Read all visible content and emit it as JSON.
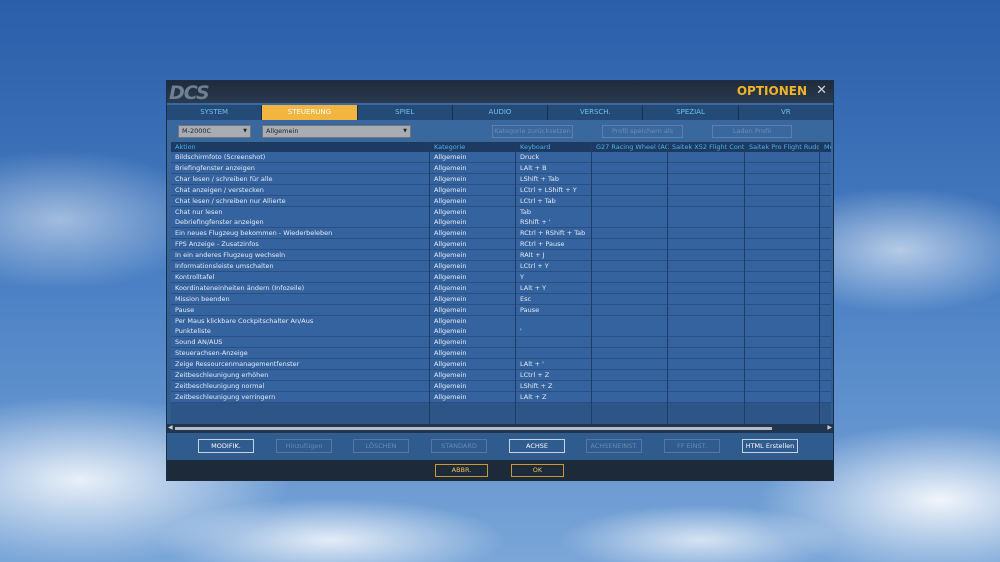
{
  "window": {
    "logo": "DCS",
    "title": "OPTIONEN",
    "close_icon": "close-icon"
  },
  "tabs": [
    {
      "label": "SYSTEM"
    },
    {
      "label": "STEUERUNG",
      "active": true
    },
    {
      "label": "SPIEL"
    },
    {
      "label": "AUDIO"
    },
    {
      "label": "VERSCH."
    },
    {
      "label": "SPEZIAL"
    },
    {
      "label": "VR"
    }
  ],
  "toolbar": {
    "aircraft": "M-2000C",
    "category": "Allgemein",
    "reset_category": "Kategorie zurücksetzen",
    "save_profile": "Profil speichern als",
    "load_profile": "Laden Profil"
  },
  "columns": [
    "Aktion",
    "Kategorie",
    "Keyboard",
    "G27 Racing Wheel (AC",
    "Saitek X52 Flight Cont",
    "Saitek Pro Flight Rudd",
    "Mo"
  ],
  "rows": [
    [
      "Bildschirmfoto (Screenshot)",
      "Allgemein",
      "Druck"
    ],
    [
      "Briefingfenster anzeigen",
      "Allgemein",
      "LAlt + B"
    ],
    [
      "Char lesen / schreiben für alle",
      "Allgemein",
      "LShift + Tab"
    ],
    [
      "Chat anzeigen / verstecken",
      "Allgemein",
      "LCtrl + LShift + Y"
    ],
    [
      "Chat lesen / schreiben nur Allierte",
      "Allgemein",
      "LCtrl + Tab"
    ],
    [
      "Chat nur lesen",
      "Allgemein",
      "Tab"
    ],
    [
      "Debriefingfenster anzeigen",
      "Allgemein",
      "RShift + '"
    ],
    [
      "Ein neues Flugzeug bekommen - Wiederbeleben",
      "Allgemein",
      "RCtrl + RShift + Tab"
    ],
    [
      "FPS Anzeige - Zusatzinfos",
      "Allgemein",
      "RCtrl + Pause"
    ],
    [
      "In ein anderes Flugzeug wechseln",
      "Allgemein",
      "RAlt + J"
    ],
    [
      "Informationsleiste umschalten",
      "Allgemein",
      "LCtrl + Y"
    ],
    [
      "Kontrolltafel",
      "Allgemein",
      "Y"
    ],
    [
      "Koordinateneinheiten ändern (Infozeile)",
      "Allgemein",
      "LAlt + Y"
    ],
    [
      "Mission beenden",
      "Allgemein",
      "Esc"
    ],
    [
      "Pause",
      "Allgemein",
      "Pause"
    ],
    [
      "Per Maus klickbare Cockpitschalter An/Aus",
      "Allgemein",
      ""
    ],
    [
      "Punkteliste",
      "Allgemein",
      "'"
    ],
    [
      "Sound AN/AUS",
      "Allgemein",
      ""
    ],
    [
      "Steuerachsen-Anzeige",
      "Allgemein",
      ""
    ],
    [
      "Zeige Ressourcenmanagementfenster",
      "Allgemein",
      "LAlt + '"
    ],
    [
      "Zeitbeschleunigung erhöhen",
      "Allgemein",
      "LCtrl + Z"
    ],
    [
      "Zeitbeschleunigung normal",
      "Allgemein",
      "LShift + Z"
    ],
    [
      "Zeitbeschleunigung verringern",
      "Allgemein",
      "LAlt + Z"
    ]
  ],
  "actions": [
    {
      "label": "MODIFIK.",
      "enabled": true
    },
    {
      "label": "Hinzufügen",
      "enabled": false
    },
    {
      "label": "LÖSCHEN",
      "enabled": false
    },
    {
      "label": "STANDARD",
      "enabled": false
    },
    {
      "label": "ACHSE",
      "enabled": true
    },
    {
      "label": "ACHSENEINST.",
      "enabled": false
    },
    {
      "label": "FF EINST.",
      "enabled": false
    },
    {
      "label": "HTML Erstellen",
      "enabled": true
    }
  ],
  "footer": {
    "cancel": "ABBR.",
    "ok": "OK"
  },
  "colors": {
    "accent": "#f2b640",
    "header_text": "#4db2e8"
  }
}
